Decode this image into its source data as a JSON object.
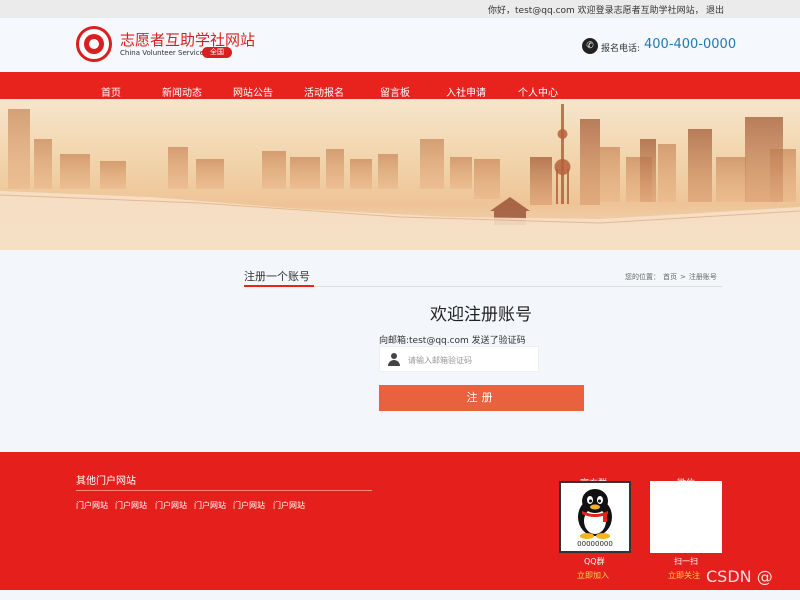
{
  "topbar": {
    "welcome": "你好，test@qq.com 欢迎登录志愿者互助学社网站，",
    "logout": "退出"
  },
  "header": {
    "site_title": "志愿者互助学社网站",
    "site_subtitle": "China Volunteer Service",
    "badge": "全国",
    "phone_label": "报名电话:",
    "phone_number": "400-400-0000",
    "phone_icon": "phone-icon"
  },
  "nav": {
    "items": [
      "首页",
      "新闻动态",
      "网站公告",
      "活动报名",
      "留言板",
      "入社申请",
      "个人中心"
    ]
  },
  "content": {
    "section_title": "注册一个账号",
    "breadcrumb": {
      "prefix": "您的位置：",
      "home": "首页",
      "separator": ">",
      "current": "注册账号"
    },
    "form_heading": "欢迎注册账号",
    "sent_message": "向邮箱:test@qq.com 发送了验证码",
    "code_placeholder": "请输入邮箱验证码",
    "code_value": "",
    "register_label": "注册"
  },
  "footer": {
    "title": "其他门户网站",
    "links": [
      "门户网站",
      "门户网站",
      "门户网站",
      "门户网站",
      "门户网站",
      "门户网站"
    ],
    "qq_header": "官方群",
    "wx_header": "微信",
    "qq_number": "00000000",
    "qq_label": "QQ群",
    "qq_action": "立即加入",
    "wx_label": "扫一扫",
    "wx_action": "立即关注",
    "watermark": "CSDN @"
  },
  "colors": {
    "brand_red": "#e8221d",
    "button": "#e8623f",
    "phone": "#1e7ab8",
    "action_yellow": "#ffd34d"
  }
}
